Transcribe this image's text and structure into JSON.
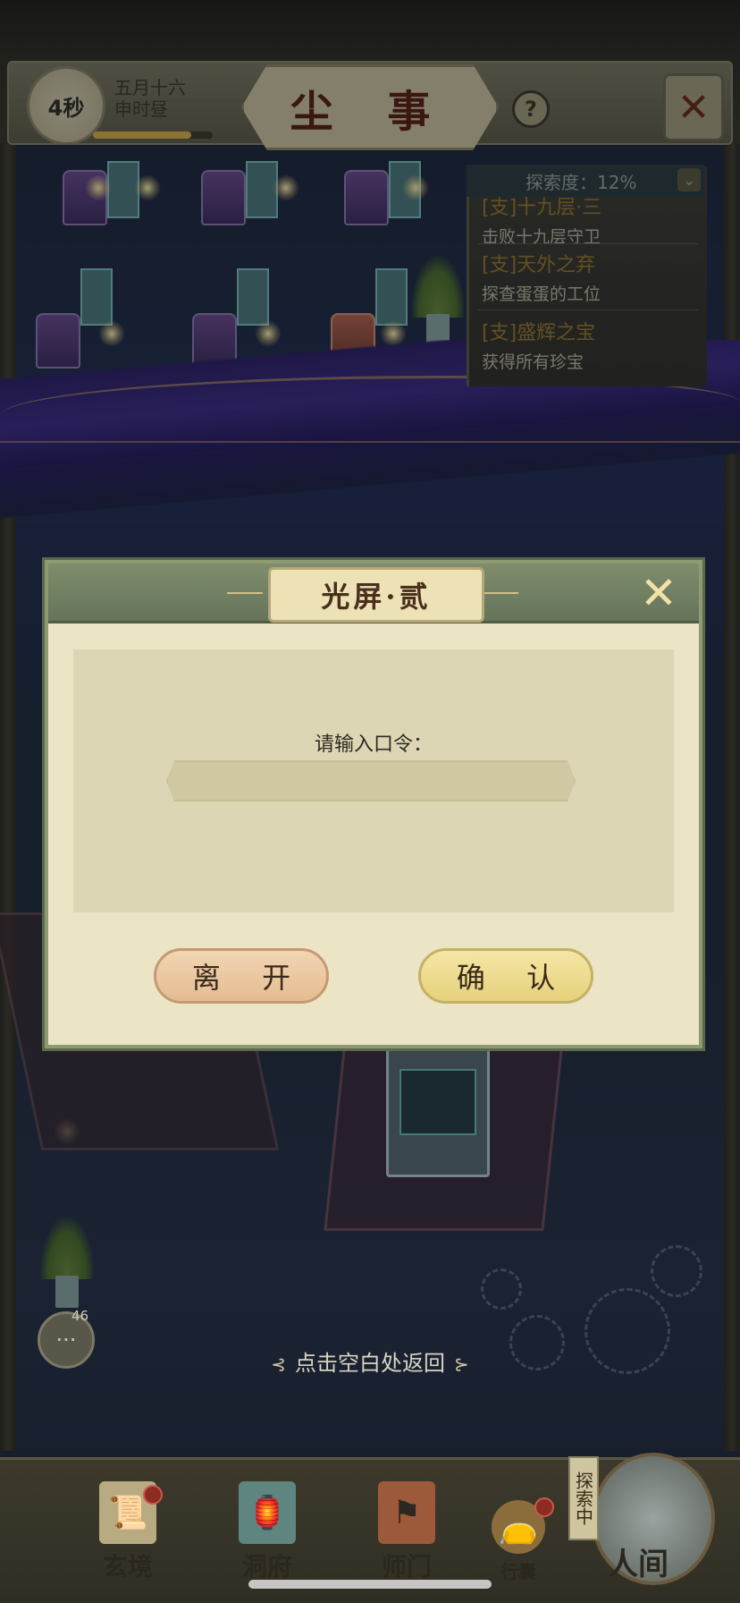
{
  "hud": {
    "timer": "4秒",
    "date_line1": "五月十六",
    "date_line2": "申时昼",
    "title": "尘 事",
    "help_icon": "?",
    "close_icon": "✕"
  },
  "explore": {
    "label": "探索度：12%",
    "chevron": "⌄"
  },
  "quests": [
    {
      "title": "[支]十九层·三",
      "desc": "击败十九层守卫"
    },
    {
      "title": "[支]天外之弃",
      "desc": "探查蛋蛋的工位"
    },
    {
      "title": "[支]盛辉之宝",
      "desc": "获得所有珍宝"
    }
  ],
  "dialog": {
    "title": "光屏·贰",
    "close_icon": "✕",
    "prompt": "请输入口令：",
    "input_value": "",
    "input_placeholder": "",
    "leave_label": "离 开",
    "confirm_label": "确 认"
  },
  "tap_hint": "点击空白处返回",
  "chat": {
    "badge": "46",
    "icon": "chat-bubble-icon"
  },
  "bottom_nav": [
    {
      "label": "玄境",
      "icon": "scroll-icon",
      "has_dot": true
    },
    {
      "label": "洞府",
      "icon": "lantern-icon",
      "has_dot": false
    },
    {
      "label": "师门",
      "icon": "banner-icon",
      "has_dot": false
    },
    {
      "label": "行囊",
      "icon": "bag-icon",
      "has_dot": true
    }
  ],
  "explore_tag": "探索中",
  "world_label": "人间",
  "colors": {
    "dialog_bg": "#ebe5c6",
    "title_red": "#5a1e12",
    "leave_btn": "#ecc9a3",
    "confirm_btn": "#ede08f"
  }
}
